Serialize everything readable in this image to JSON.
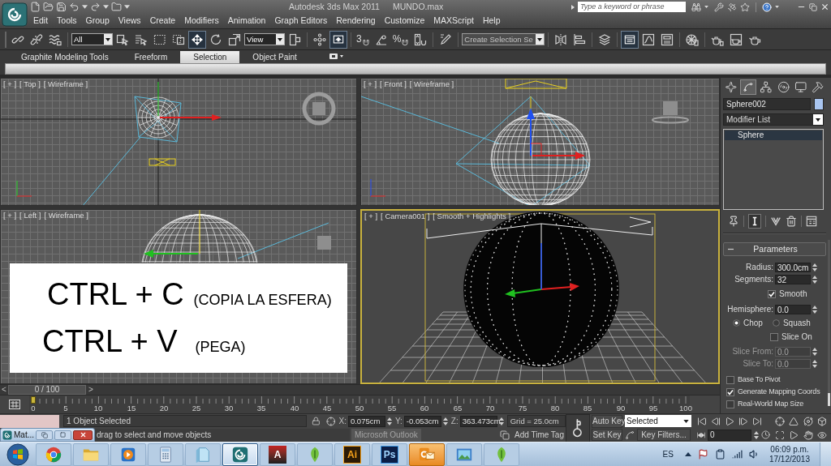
{
  "title_bar": {
    "title": "Autodesk 3ds Max 2011",
    "file": "MUNDO.max",
    "search": {
      "placeholder": "Type a keyword or phrase"
    }
  },
  "menu": [
    "Edit",
    "Tools",
    "Group",
    "Views",
    "Create",
    "Modifiers",
    "Animation",
    "Graph Editors",
    "Rendering",
    "Customize",
    "MAXScript",
    "Help"
  ],
  "main_toolbar": {
    "selection_filter": "All",
    "coordinate_system": "View",
    "selection_set": "Create Selection Se",
    "buttons": [
      {
        "selected": false
      },
      {
        "selected": false
      },
      {
        "selected": false
      },
      {
        "selected": false
      },
      {
        "selected": false
      },
      {
        "selected": false
      },
      {
        "selected": false
      },
      {
        "selected": true
      },
      {
        "selected": false
      },
      {
        "selected": false
      },
      {
        "selected": false
      },
      {
        "selected": false
      },
      {
        "selected": true
      },
      {
        "label": "3",
        "selected": false
      },
      {
        "selected": false
      },
      {
        "label": "%",
        "selected": false
      },
      {
        "selected": false
      },
      {
        "selected": false
      },
      {
        "selected": false
      },
      {
        "selected": false
      },
      {
        "selected": false
      },
      {
        "selected": true
      },
      {
        "selected": false
      },
      {
        "selected": false
      },
      {
        "selected": false
      },
      {
        "selected": false
      },
      {
        "selected": false
      },
      {
        "selected": false
      }
    ]
  },
  "ribbon": {
    "tabs": [
      {
        "label": "Graphite Modeling Tools",
        "selected": false
      },
      {
        "label": "Freeform",
        "selected": false
      },
      {
        "label": "Selection",
        "selected": true
      },
      {
        "label": "Object Paint",
        "selected": false
      }
    ]
  },
  "viewports": [
    {
      "kind": "top",
      "menu": "[ + ]",
      "view": "[ Top ]",
      "shading": "[ Wireframe ]",
      "active": false
    },
    {
      "kind": "front",
      "menu": "[ + ]",
      "view": "[ Front ]",
      "shading": "[ Wireframe ]",
      "active": false
    },
    {
      "kind": "left",
      "menu": "[ + ]",
      "view": "[ Left ]",
      "shading": "[ Wireframe ]",
      "active": false
    },
    {
      "kind": "camera",
      "menu": "[ + ]",
      "view": "[ Camera001 ]",
      "shading": "[ Smooth + Highlights ]",
      "active": true
    }
  ],
  "annotation": {
    "lines": [
      {
        "shortcut": "CTRL + C",
        "note": "(COPIA LA ESFERA)"
      },
      {
        "shortcut": "CTRL + V",
        "note": "(PEGA)"
      }
    ]
  },
  "time_slider": {
    "prev": "<",
    "label": "0 / 100",
    "next": ">",
    "level": 0
  },
  "track_bar": {
    "ticks": [
      "0",
      "5",
      "10",
      "15",
      "20",
      "25",
      "30",
      "35",
      "40",
      "45",
      "50",
      "55",
      "60",
      "65",
      "70",
      "75",
      "80",
      "85",
      "90",
      "95",
      "100"
    ],
    "level": 0
  },
  "command_panel": {
    "tabs": [
      {
        "selected": false
      },
      {
        "selected": true
      },
      {
        "selected": false
      },
      {
        "selected": false
      },
      {
        "selected": false
      },
      {
        "selected": false
      }
    ],
    "object_name": "Sphere002",
    "modifier_list": "Modifier List",
    "stack": [
      {
        "label": "Sphere",
        "selected": true
      }
    ],
    "stack_tools": [
      {
        "selected": false
      },
      {
        "selected": true
      },
      {
        "selected": false
      },
      {
        "selected": false
      },
      {
        "selected": false
      }
    ],
    "rollout": {
      "title": "Parameters",
      "expanded": true,
      "radius": {
        "label": "Radius:",
        "value": "300.0cm",
        "disabled": false
      },
      "segments": {
        "label": "Segments:",
        "value": "32",
        "disabled": false
      },
      "smooth": {
        "label": "Smooth",
        "checked": true
      },
      "hemisphere": {
        "label": "Hemisphere:",
        "value": "0.0",
        "disabled": false
      },
      "hemisphere_mode": [
        {
          "label": "Chop",
          "selected": true
        },
        {
          "label": "Squash",
          "selected": false
        }
      ],
      "slice_on": {
        "label": "Slice On",
        "checked": false
      },
      "slice_from": {
        "label": "Slice From:",
        "value": "0.0",
        "disabled": true
      },
      "slice_to": {
        "label": "Slice To:",
        "value": "0.0",
        "disabled": true
      },
      "base_to_pivot": {
        "label": "Base To Pivot",
        "checked": false
      },
      "generate_mapping": {
        "label": "Generate Mapping Coords",
        "checked": true
      },
      "real_world": {
        "label": "Real-World Map Size",
        "checked": false
      }
    }
  },
  "status_bar": {
    "selection": "1 Object Selected",
    "coordinates": [
      {
        "axis": "X:",
        "value": "0.075cm"
      },
      {
        "axis": "Y:",
        "value": "-0.053cm"
      },
      {
        "axis": "Z:",
        "value": "363.473cm"
      }
    ],
    "grid": "Grid = 25.0cm",
    "prompt": "drag to select and move objects",
    "time_tag": "Add Time Tag"
  },
  "animation": {
    "auto_key": {
      "label": "Auto Key",
      "on": false
    },
    "key_set": "Selected",
    "set_key": {
      "label": "Set Key",
      "on": false
    },
    "key_filters": "Key Filters...",
    "frame": "0"
  },
  "floating_window": {
    "title": "Mat..."
  },
  "tooltip": "Microsoft Outlook",
  "taskbar": {
    "apps": [
      {
        "selected": false,
        "attention": false
      },
      {
        "selected": false,
        "attention": false
      },
      {
        "selected": false,
        "attention": false
      },
      {
        "selected": false,
        "attention": false
      },
      {
        "selected": false,
        "attention": false
      },
      {
        "selected": true,
        "attention": false
      },
      {
        "label": "A",
        "selected": false,
        "attention": false
      },
      {
        "selected": false,
        "attention": false
      },
      {
        "label": "Ai",
        "selected": false,
        "attention": false
      },
      {
        "label": "Ps",
        "selected": false,
        "attention": false
      },
      {
        "selected": false,
        "attention": true
      },
      {
        "selected": false,
        "attention": false
      },
      {
        "selected": false,
        "attention": false
      }
    ],
    "language": "ES",
    "time": "06:09 p.m.",
    "date": "17/12/2013"
  }
}
